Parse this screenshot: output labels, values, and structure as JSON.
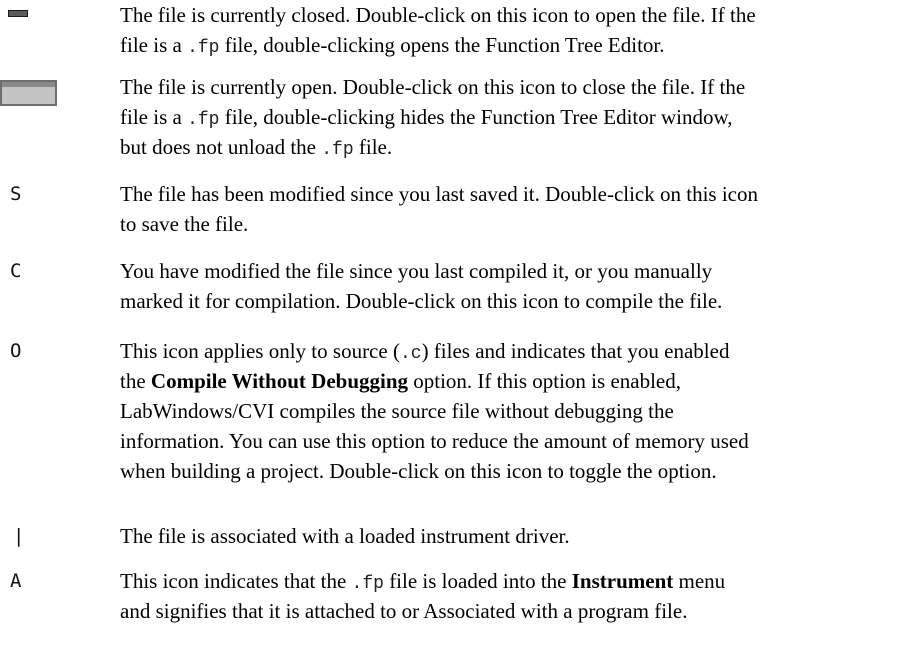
{
  "entries": [
    {
      "icon": "file-closed-icon",
      "lines": [
        [
          "The file is currently closed. Double-click on this icon to open the file. If the"
        ],
        [
          "file is a ",
          {
            "mono": ".fp"
          },
          " file, double-clicking opens the Function Tree Editor."
        ]
      ]
    },
    {
      "icon": "file-open-icon",
      "lines": [
        [
          "The file is currently open. Double-click on this icon to close the file. If the"
        ],
        [
          "file is a ",
          {
            "mono": ".fp"
          },
          " file, double-clicking hides the Function Tree Editor window,"
        ],
        [
          "but does not unload the ",
          {
            "mono": ".fp"
          },
          " file."
        ]
      ]
    },
    {
      "icon": "save-icon",
      "glyph": "S",
      "lines": [
        [
          "The file has been modified since you last saved it. Double-click on this icon"
        ],
        [
          "to save the file."
        ]
      ]
    },
    {
      "icon": "compile-icon",
      "glyph": "C",
      "lines": [
        [
          "You have modified the file since you last compiled it, or you manually"
        ],
        [
          "marked it for compilation. Double-click on this icon to compile the file."
        ]
      ]
    },
    {
      "icon": "compile-option-icon",
      "glyph": "O",
      "lines": [
        [
          "This icon applies only to source (",
          {
            "mono": ".c"
          },
          ") files and indicates that you enabled"
        ],
        [
          "the ",
          {
            "bold": "Compile Without Debugging"
          },
          " option. If this option is enabled,"
        ],
        [
          "LabWindows/CVI compiles the source file without debugging the"
        ],
        [
          "information. You can use this option to reduce the amount of memory used"
        ],
        [
          "when building a project. Double-click on this icon to toggle the option."
        ]
      ]
    },
    {
      "icon": "instrument-driver-icon",
      "glyph": "|",
      "lines": [
        [
          "The file is associated with a loaded instrument driver."
        ]
      ]
    },
    {
      "icon": "associated-icon",
      "glyph": "A",
      "lines": [
        [
          "This icon indicates that the ",
          {
            "mono": ".fp"
          },
          " file is loaded into the ",
          {
            "bold": "Instrument"
          },
          " menu"
        ],
        [
          "and signifies that it is attached to or Associated with a program file."
        ]
      ]
    }
  ]
}
